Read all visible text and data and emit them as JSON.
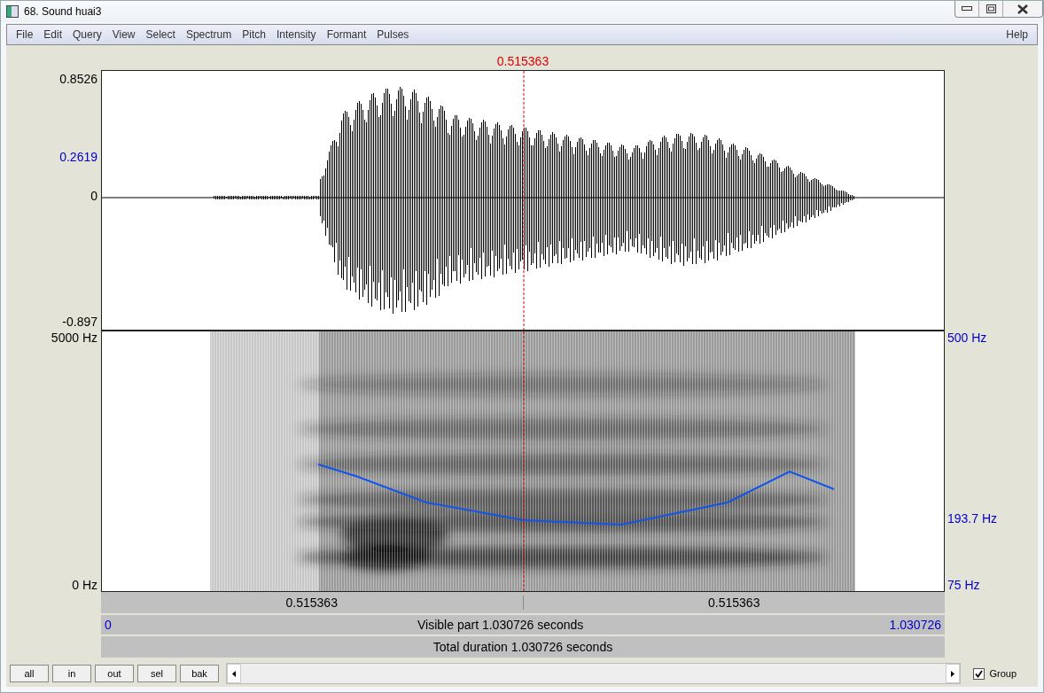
{
  "window": {
    "title": "68. Sound huai3"
  },
  "menu": {
    "items": [
      "File",
      "Edit",
      "Query",
      "View",
      "Select",
      "Spectrum",
      "Pitch",
      "Intensity",
      "Formant",
      "Pulses"
    ],
    "help": "Help"
  },
  "cursor_time": "0.515363",
  "waveform": {
    "y_labels": [
      {
        "text": "0.8526",
        "kind": "max"
      },
      {
        "text": "0.2619",
        "kind": "cursor"
      },
      {
        "text": "0",
        "kind": "zero"
      },
      {
        "text": "-0.897",
        "kind": "min"
      }
    ]
  },
  "spectrogram": {
    "left_labels": [
      {
        "text": "5000 Hz",
        "kind": "top"
      },
      {
        "text": "0 Hz",
        "kind": "bottom"
      }
    ],
    "right_labels": [
      {
        "text": "500 Hz",
        "kind": "top"
      },
      {
        "text": "193.7 Hz",
        "kind": "value"
      },
      {
        "text": "75 Hz",
        "kind": "bottom"
      }
    ]
  },
  "time_bars": {
    "segments": [
      "0.515363",
      "0.515363"
    ],
    "start": "0",
    "visible": "Visible part 1.030726 seconds",
    "end": "1.030726",
    "total": "Total duration 1.030726 seconds"
  },
  "buttons": [
    "all",
    "in",
    "out",
    "sel",
    "bak"
  ],
  "group": {
    "label": "Group",
    "checked": true
  }
}
